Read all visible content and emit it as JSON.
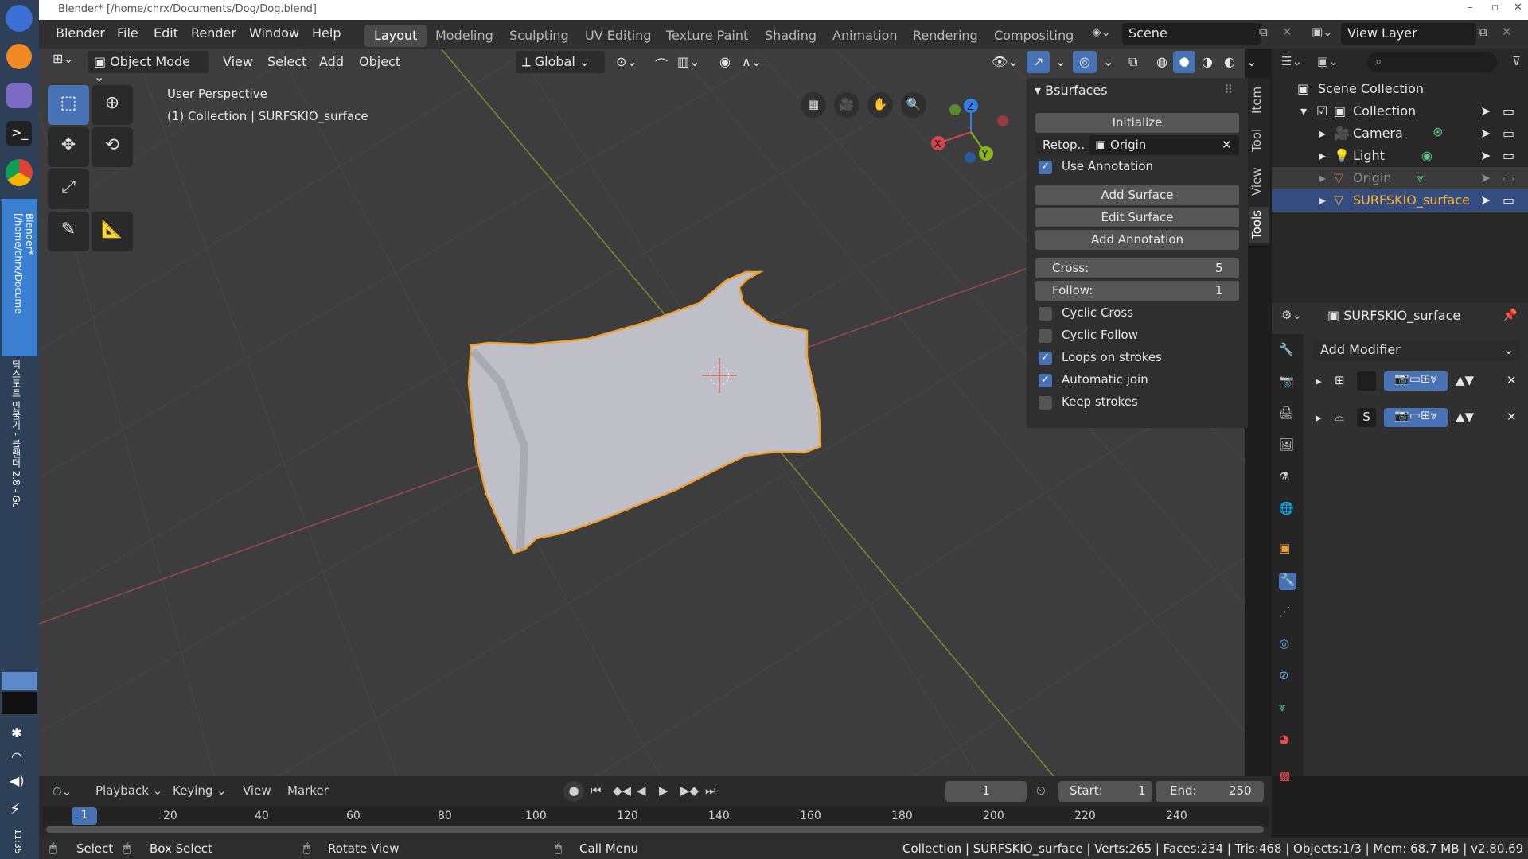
{
  "window_title": "Blender* [/home/chrx/Documents/Dog/Dog.blend]",
  "taskbar": {
    "side_text": "Blender* [/home/chrx/Docume",
    "chrome_text": "딕스토트 인물기 - 블랜더 2.8 - Gc",
    "clock": "11:35"
  },
  "menu": [
    "Blender",
    "File",
    "Edit",
    "Render",
    "Window",
    "Help"
  ],
  "workspaces": [
    "Layout",
    "Modeling",
    "Sculpting",
    "UV Editing",
    "Texture Paint",
    "Shading",
    "Animation",
    "Rendering",
    "Compositing"
  ],
  "scene": {
    "label": "Scene"
  },
  "view_layer": {
    "label": "View Layer"
  },
  "viewport_header": {
    "mode": "Object Mode",
    "items": [
      "View",
      "Select",
      "Add",
      "Object"
    ],
    "transform": "Global"
  },
  "viewport": {
    "perspective": "User Perspective",
    "collection_line": "(1) Collection | SURFSKIO_surface",
    "gizmo": {
      "x": "X",
      "y": "Y",
      "z": "Z"
    }
  },
  "n_panel": {
    "title": "Bsurfaces",
    "initialize": "Initialize",
    "retop_label": "Retop..",
    "retop_value": "Origin",
    "use_annotation": "Use Annotation",
    "add_surface": "Add Surface",
    "edit_surface": "Edit Surface",
    "add_annotation": "Add Annotation",
    "cross_label": "Cross:",
    "cross_value": "5",
    "follow_label": "Follow:",
    "follow_value": "1",
    "checks": [
      {
        "label": "Cyclic Cross",
        "on": false
      },
      {
        "label": "Cyclic Follow",
        "on": false
      },
      {
        "label": "Loops on strokes",
        "on": true
      },
      {
        "label": "Automatic join",
        "on": true
      },
      {
        "label": "Keep strokes",
        "on": false
      }
    ],
    "tabs": [
      "Item",
      "Tool",
      "View",
      "Tools"
    ]
  },
  "outliner": {
    "root": "Scene Collection",
    "collection": "Collection",
    "items": [
      "Camera",
      "Light",
      "Origin",
      "SURFSKIO_surface"
    ]
  },
  "properties": {
    "object_name": "SURFSKIO_surface",
    "add_modifier": "Add Modifier",
    "modifier2_letter": "S"
  },
  "timeline": {
    "menus": [
      "Playback",
      "Keying",
      "View",
      "Marker"
    ],
    "current_frame": "1",
    "start_label": "Start:",
    "start_value": "1",
    "end_label": "End:",
    "end_value": "250",
    "ruler": [
      "20",
      "40",
      "60",
      "80",
      "100",
      "120",
      "140",
      "160",
      "180",
      "200",
      "220",
      "240"
    ],
    "playhead": "1"
  },
  "statusbar": {
    "select": "Select",
    "box_select": "Box Select",
    "rotate_view": "Rotate View",
    "call_menu": "Call Menu",
    "stats": "Collection | SURFSKIO_surface | Verts:265 | Faces:234 | Tris:468 | Objects:1/3 | Mem: 68.7 MB | v2.80.69"
  },
  "colors": {
    "accent": "#4772b3",
    "selection_outline": "#f0a030",
    "axis_x": "#d0464e",
    "axis_y": "#8ab51b",
    "axis_z": "#2f82e8"
  }
}
